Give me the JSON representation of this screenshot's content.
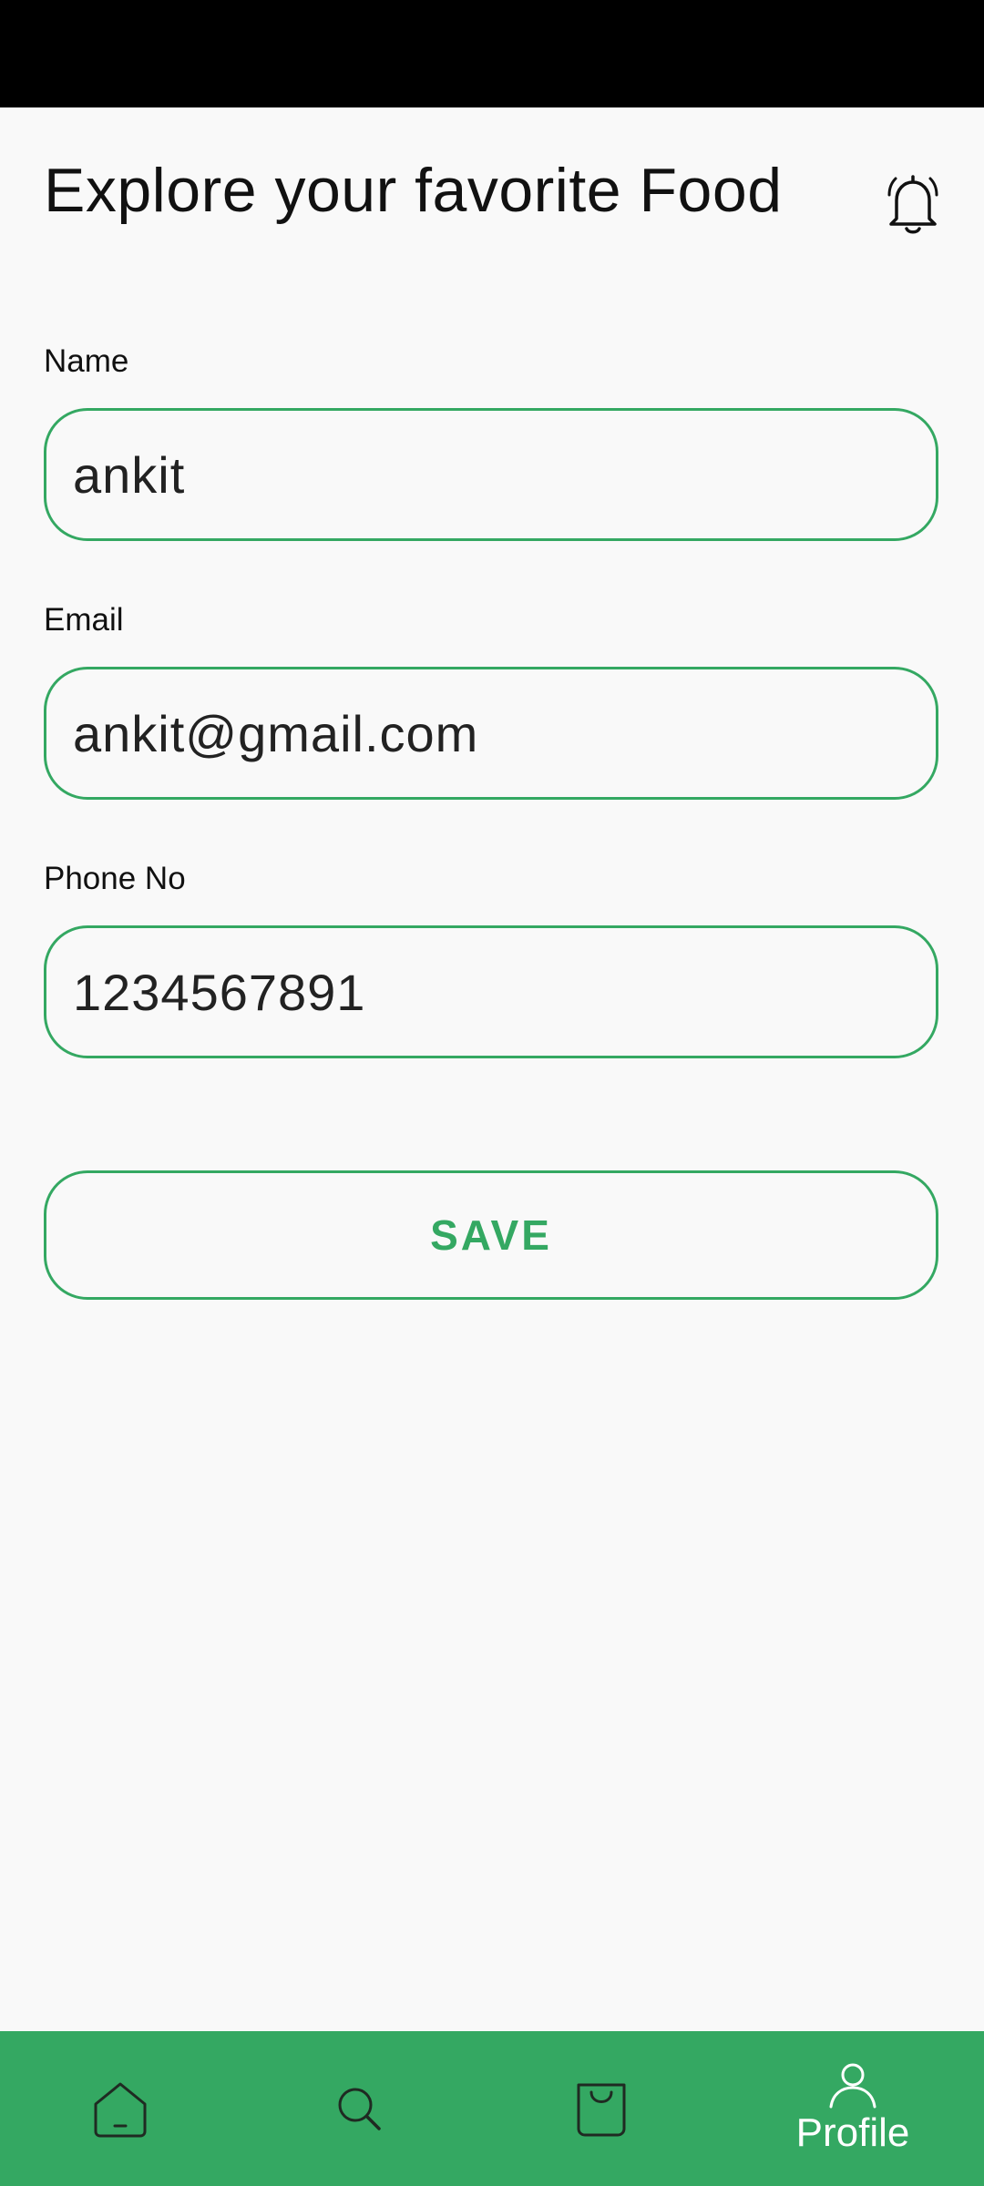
{
  "header": {
    "title": "Explore your favorite Food",
    "notification_icon": "bell-icon"
  },
  "form": {
    "name": {
      "label": "Name",
      "value": "ankit"
    },
    "email": {
      "label": "Email",
      "value": "ankit@gmail.com"
    },
    "phone": {
      "label": "Phone No",
      "value": "1234567891"
    },
    "save_label": "SAVE"
  },
  "bottom_nav": {
    "items": [
      {
        "icon": "home-icon",
        "label": ""
      },
      {
        "icon": "search-icon",
        "label": ""
      },
      {
        "icon": "shopping-bag-icon",
        "label": ""
      },
      {
        "icon": "profile-icon",
        "label": "Profile",
        "active": true
      }
    ]
  },
  "colors": {
    "accent": "#34A862",
    "background": "#F9F9F9",
    "status_bar": "#000000"
  }
}
